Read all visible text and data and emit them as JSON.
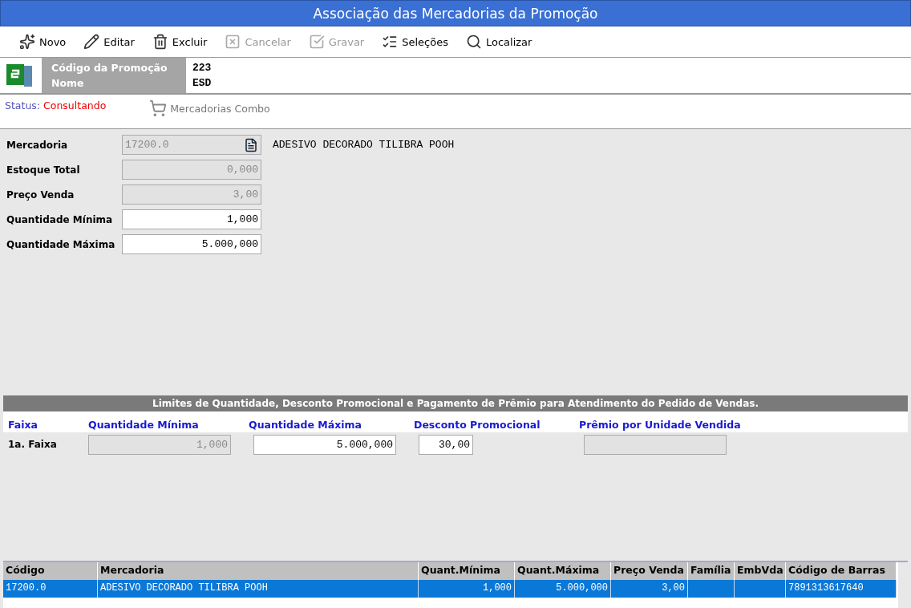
{
  "window": {
    "title": "Associação das Mercadorias da Promoção"
  },
  "toolbar": [
    {
      "label": "Novo",
      "kind": "new",
      "disabled": false
    },
    {
      "label": "Editar",
      "kind": "edit",
      "disabled": false
    },
    {
      "label": "Excluir",
      "kind": "delete",
      "disabled": false
    },
    {
      "label": "Cancelar",
      "kind": "cancel",
      "disabled": true
    },
    {
      "label": "Gravar",
      "kind": "save",
      "disabled": true
    },
    {
      "label": "Seleções",
      "kind": "list",
      "disabled": false
    },
    {
      "label": "Localizar",
      "kind": "search",
      "disabled": false
    }
  ],
  "header": {
    "fields": [
      {
        "label": "Código da Promoção",
        "value": "223"
      },
      {
        "label": "Nome",
        "value": "ESD"
      }
    ]
  },
  "status": {
    "label": "Status:",
    "value": "Consultando",
    "combo_button": "Mercadorias Combo"
  },
  "form": {
    "fields": [
      {
        "label": "Mercadoria",
        "value": "17200.0",
        "disabled": true,
        "lookup": true,
        "description": "ADESIVO DECORADO TILIBRA POOH"
      },
      {
        "label": "Estoque Total",
        "value": "0,000",
        "disabled": true,
        "lookup": false
      },
      {
        "label": "Preço Venda",
        "value": "3,00",
        "disabled": true,
        "lookup": false
      },
      {
        "label": "Quantidade Mínima",
        "value": "1,000",
        "disabled": false,
        "lookup": false
      },
      {
        "label": "Quantidade Máxima",
        "value": "5.000,000",
        "disabled": false,
        "lookup": false
      }
    ]
  },
  "limits": {
    "title": "Limites de Quantidade, Desconto Promocional  e Pagamento de Prêmio para Atendimento do Pedido de Vendas.",
    "columns": [
      "Faixa",
      "Quantidade Mínima",
      "Quantidade Máxima",
      "Desconto Promocional",
      "Prêmio por Unidade Vendida"
    ],
    "rows": [
      {
        "cells": [
          {
            "kind": "label",
            "value": "1a. Faixa"
          },
          {
            "kind": "input",
            "value": "1,000",
            "disabled": true
          },
          {
            "kind": "input",
            "value": "5.000,000",
            "disabled": false
          },
          {
            "kind": "input",
            "value": "30,00",
            "disabled": false
          },
          {
            "kind": "input",
            "disabled": true
          }
        ]
      }
    ]
  },
  "table": {
    "columns": [
      "Código",
      "Mercadoria",
      "Quant.Mínima",
      "Quant.Máxima",
      "Preço Venda",
      "Família",
      "EmbVda",
      "Código de Barras"
    ],
    "rows": [
      {
        "selected": true,
        "cells": [
          "17200.0",
          "ADESIVO DECORADO TILIBRA POOH",
          "1,000",
          "5.000,000",
          "3,00",
          "",
          "",
          "7891313617640"
        ]
      }
    ]
  }
}
